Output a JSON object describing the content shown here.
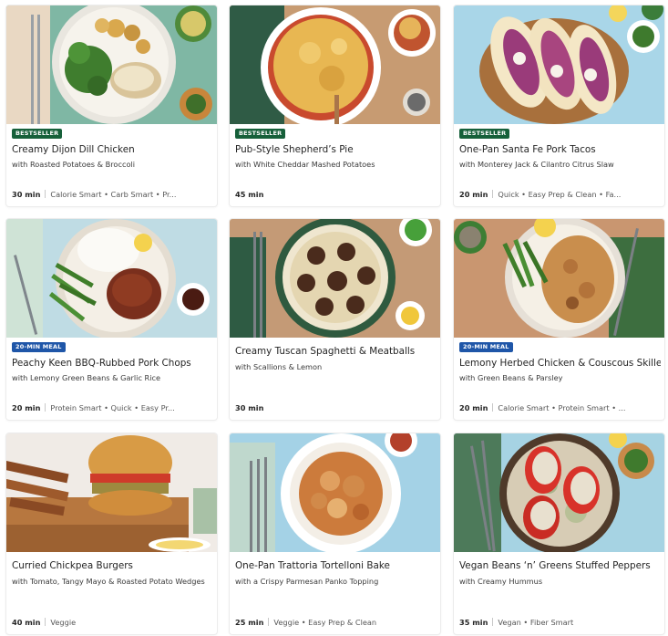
{
  "recipes": [
    {
      "badge": "BESTSELLER",
      "title": "Creamy Dijon Dill Chicken",
      "subtitle": "with Roasted Potatoes & Broccoli",
      "time": "30 min",
      "tags": "Calorie Smart • Carb Smart • Pr..."
    },
    {
      "badge": "BESTSELLER",
      "title": "Pub-Style Shepherd’s Pie",
      "subtitle": "with White Cheddar Mashed Potatoes",
      "time": "45 min",
      "tags": ""
    },
    {
      "badge": "BESTSELLER",
      "title": "One-Pan Santa Fe Pork Tacos",
      "subtitle": "with Monterey Jack & Cilantro Citrus Slaw",
      "time": "20 min",
      "tags": "Quick • Easy Prep & Clean • Fa..."
    },
    {
      "badge": "20-MIN MEAL",
      "title": "Peachy Keen BBQ-Rubbed Pork Chops",
      "subtitle": "with Lemony Green Beans & Garlic Rice",
      "time": "20 min",
      "tags": "Protein Smart • Quick • Easy Pr..."
    },
    {
      "badge": "",
      "title": "Creamy Tuscan Spaghetti & Meatballs",
      "subtitle": "with Scallions & Lemon",
      "time": "30 min",
      "tags": ""
    },
    {
      "badge": "20-MIN MEAL",
      "title": "Lemony Herbed Chicken & Couscous Skillet",
      "subtitle": "with Green Beans & Parsley",
      "time": "20 min",
      "tags": "Calorie Smart • Protein Smart • ..."
    },
    {
      "badge": "",
      "title": "Curried Chickpea Burgers",
      "subtitle": "with Tomato, Tangy Mayo & Roasted Potato Wedges",
      "time": "40 min",
      "tags": "Veggie"
    },
    {
      "badge": "",
      "title": "One-Pan Trattoria Tortelloni Bake",
      "subtitle": "with a Crispy Parmesan Panko Topping",
      "time": "25 min",
      "tags": "Veggie • Easy Prep & Clean"
    },
    {
      "badge": "",
      "title": "Vegan Beans ‘n’ Greens Stuffed Peppers",
      "subtitle": "with Creamy Hummus",
      "time": "35 min",
      "tags": "Vegan • Fiber Smart"
    }
  ],
  "colors": {
    "bestseller_badge": "#16603a",
    "quick_badge": "#1f56a8",
    "title_text": "#242424"
  }
}
